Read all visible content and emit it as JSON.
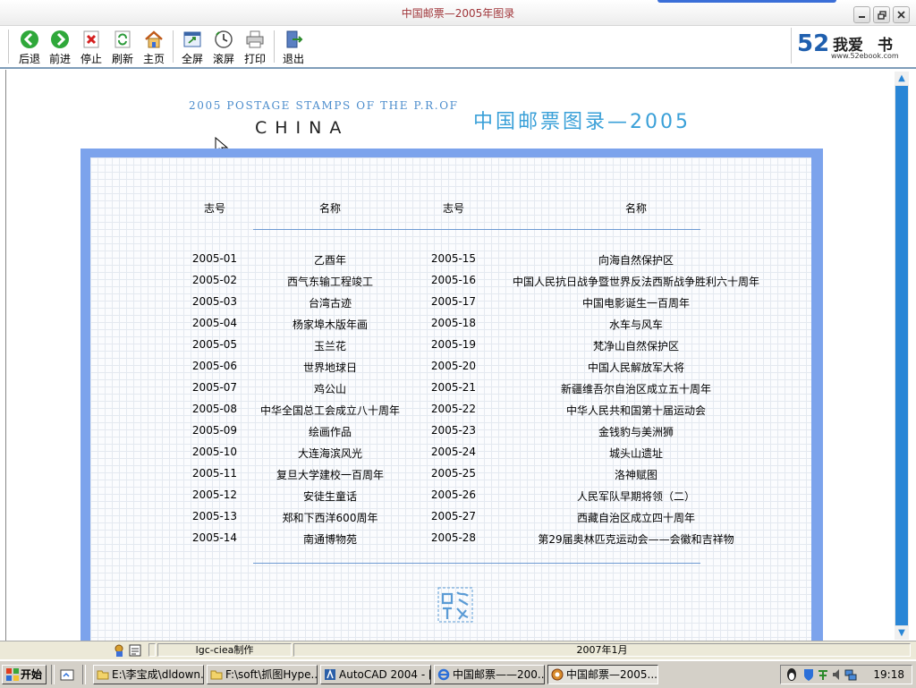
{
  "window": {
    "title": "中国邮票—2005年图录",
    "controls": {
      "minimize": "minimize",
      "restore": "restore",
      "close": "close"
    }
  },
  "toolbar": {
    "buttons": [
      {
        "label": "后退",
        "icon": "back-arrow-icon"
      },
      {
        "label": "前进",
        "icon": "forward-arrow-icon"
      },
      {
        "label": "停止",
        "icon": "stop-icon"
      },
      {
        "label": "刷新",
        "icon": "refresh-icon"
      },
      {
        "label": "主页",
        "icon": "home-icon"
      },
      {
        "label": "全屏",
        "icon": "fullscreen-icon"
      },
      {
        "label": "滚屏",
        "icon": "autoscroll-icon"
      },
      {
        "label": "打印",
        "icon": "printer-icon"
      },
      {
        "label": "退出",
        "icon": "exit-icon"
      }
    ],
    "logo": {
      "text": "我爱",
      "char": "书",
      "number": "52",
      "url": "www.52ebook.com"
    }
  },
  "page": {
    "english_title": "2005 POSTAGE STAMPS OF THE P.R.OF",
    "china": "CHINA",
    "chinese_title": "中国邮票图录—2005",
    "headers": {
      "no1": "志号",
      "name1": "名称",
      "no2": "志号",
      "name2": "名称"
    },
    "rows": [
      {
        "no1": "2005-01",
        "name1": "乙酉年",
        "no2": "2005-15",
        "name2": "向海自然保护区"
      },
      {
        "no1": "2005-02",
        "name1": "西气东输工程竣工",
        "no2": "2005-16",
        "name2": "中国人民抗日战争暨世界反法西斯战争胜利六十周年"
      },
      {
        "no1": "2005-03",
        "name1": "台湾古迹",
        "no2": "2005-17",
        "name2": "中国电影诞生一百周年"
      },
      {
        "no1": "2005-04",
        "name1": "杨家埠木版年画",
        "no2": "2005-18",
        "name2": "水车与风车"
      },
      {
        "no1": "2005-05",
        "name1": "玉兰花",
        "no2": "2005-19",
        "name2": "梵净山自然保护区"
      },
      {
        "no1": "2005-06",
        "name1": "世界地球日",
        "no2": "2005-20",
        "name2": "中国人民解放军大将"
      },
      {
        "no1": "2005-07",
        "name1": "鸡公山",
        "no2": "2005-21",
        "name2": "新疆维吾尔自治区成立五十周年"
      },
      {
        "no1": "2005-08",
        "name1": "中华全国总工会成立八十周年",
        "no2": "2005-22",
        "name2": "中华人民共和国第十届运动会"
      },
      {
        "no1": "2005-09",
        "name1": "绘画作品",
        "no2": "2005-23",
        "name2": "金钱豹与美洲狮"
      },
      {
        "no1": "2005-10",
        "name1": "大连海滨风光",
        "no2": "2005-24",
        "name2": "城头山遗址"
      },
      {
        "no1": "2005-11",
        "name1": "复旦大学建校一百周年",
        "no2": "2005-25",
        "name2": "洛神赋图"
      },
      {
        "no1": "2005-12",
        "name1": "安徒生童话",
        "no2": "2005-26",
        "name2": "人民军队早期将领（二）"
      },
      {
        "no1": "2005-13",
        "name1": "郑和下西洋600周年",
        "no2": "2005-27",
        "name2": "西藏自治区成立四十周年"
      },
      {
        "no1": "2005-14",
        "name1": "南通博物苑",
        "no2": "2005-28",
        "name2": "第29届奥林匹克运动会——会徽和吉祥物"
      }
    ]
  },
  "statusbar": {
    "author": "lgc-ciea制作",
    "date": "2007年1月"
  },
  "taskbar": {
    "start": "开始",
    "tasks": [
      {
        "label": "E:\\李宝成\\dldown...",
        "icon": "folder-icon"
      },
      {
        "label": "F:\\soft\\抓图Hype...",
        "icon": "folder-icon"
      },
      {
        "label": "AutoCAD 2004 - [...",
        "icon": "autocad-icon"
      },
      {
        "label": "中国邮票——200...",
        "icon": "ie-icon"
      },
      {
        "label": "中国邮票—2005...",
        "icon": "ebook-icon"
      }
    ],
    "clock": "19:18"
  }
}
